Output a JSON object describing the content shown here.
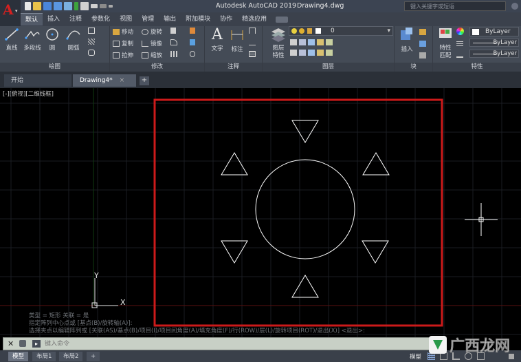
{
  "app": {
    "title": "Autodesk AutoCAD 2019",
    "file": "Drawing4.dwg",
    "search_placeholder": "键入关键字或短语",
    "logo_letter": "A"
  },
  "ribbon_tabs": [
    "默认",
    "插入",
    "注释",
    "参数化",
    "视图",
    "管理",
    "输出",
    "附加模块",
    "协作",
    "精选应用"
  ],
  "ribbon": {
    "panels": {
      "draw": "绘图",
      "modify": "修改",
      "annotation": "注释",
      "layers": "图层",
      "block": "块",
      "properties": "特性"
    },
    "draw_tools": {
      "line": "直线",
      "polyline": "多段线",
      "circle": "圆",
      "arc": "圆弧"
    },
    "modify_tools": {
      "move": "移动",
      "rotate": "旋转",
      "copy": "复制",
      "mirror": "镜像",
      "stretch": "拉伸",
      "scale": "缩放"
    },
    "annotation_tools": {
      "text": "文字",
      "dimension": "标注"
    },
    "layer_tools": {
      "properties": "图层特性",
      "current_layer": "0"
    },
    "block_tools": {
      "insert": "插入"
    },
    "property_tools": {
      "match": "特性匹配",
      "color": "ByLayer",
      "linetype": "ByLayer",
      "lineweight": "ByLayer"
    }
  },
  "file_tabs": {
    "start": "开始",
    "drawing": "Drawing4*",
    "close": "×",
    "new": "+"
  },
  "viewport_label": "[-][俯视][二维线框]",
  "ucs": {
    "y_label": "Y",
    "x_label": "X"
  },
  "command": {
    "history": [
      "类型 = 矩形  关联 = 是",
      "指定阵列中心点或 [基点(B)/旋转轴(A)]:",
      "选择夹点以编辑阵列或 [关联(AS)/基点(B)/项目(I)/项目间角度(A)/填充角度(F)/行(ROW)/层(L)/旋转项目(ROT)/退出(X)] <退出>:"
    ],
    "placeholder": "键入命令"
  },
  "layout_tabs": [
    "模型",
    "布局1",
    "布局2"
  ],
  "layout_add": "+",
  "status": {
    "mode": "模型"
  },
  "watermark": {
    "text": "广西龙网"
  },
  "colors": {
    "highlight_rect": "#cc1a1a",
    "geometry": "#ffffff",
    "grid": "#1a1d22",
    "title_bar": "#3c4452",
    "ribbon": "#444b56"
  }
}
